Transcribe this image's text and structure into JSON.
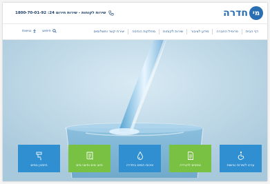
{
  "brand": {
    "logo_mark": "מי",
    "logo_text": "חדרה"
  },
  "header": {
    "service_text": "שירות לקוחות - שירות חירום 24: 1800-70-01-92"
  },
  "nav": {
    "items": [
      {
        "label": "דף הבית"
      },
      {
        "label": "פרופיל החברה"
      },
      {
        "label": "מידע לציבור"
      },
      {
        "label": "שירות לקוחות"
      },
      {
        "label": "מחלקות הנדסה"
      },
      {
        "label": "יצירת קשר ותשלומים"
      }
    ],
    "search_label": "חיפוש",
    "accessibility_label": "נגישות"
  },
  "tiles": [
    {
      "label": "חיסכון במים",
      "icon": "faucet-icon",
      "color": "#2f8fd1"
    },
    {
      "label": "חיוב מים ופיצוי מים",
      "icon": "bill-icon",
      "color": "#79c142"
    },
    {
      "label": "איכות המים בחדרה",
      "icon": "water-drop-icon",
      "color": "#2f8fd1"
    },
    {
      "label": "טפסים להורדה",
      "icon": "document-icon",
      "color": "#79c142"
    },
    {
      "label": "ערכו לשירות נגישות",
      "icon": "wheelchair-icon",
      "color": "#2f8fd1"
    }
  ],
  "colors": {
    "brand_blue": "#2a6fb4",
    "tile_blue": "#2f8fd1",
    "tile_green": "#79c142"
  }
}
